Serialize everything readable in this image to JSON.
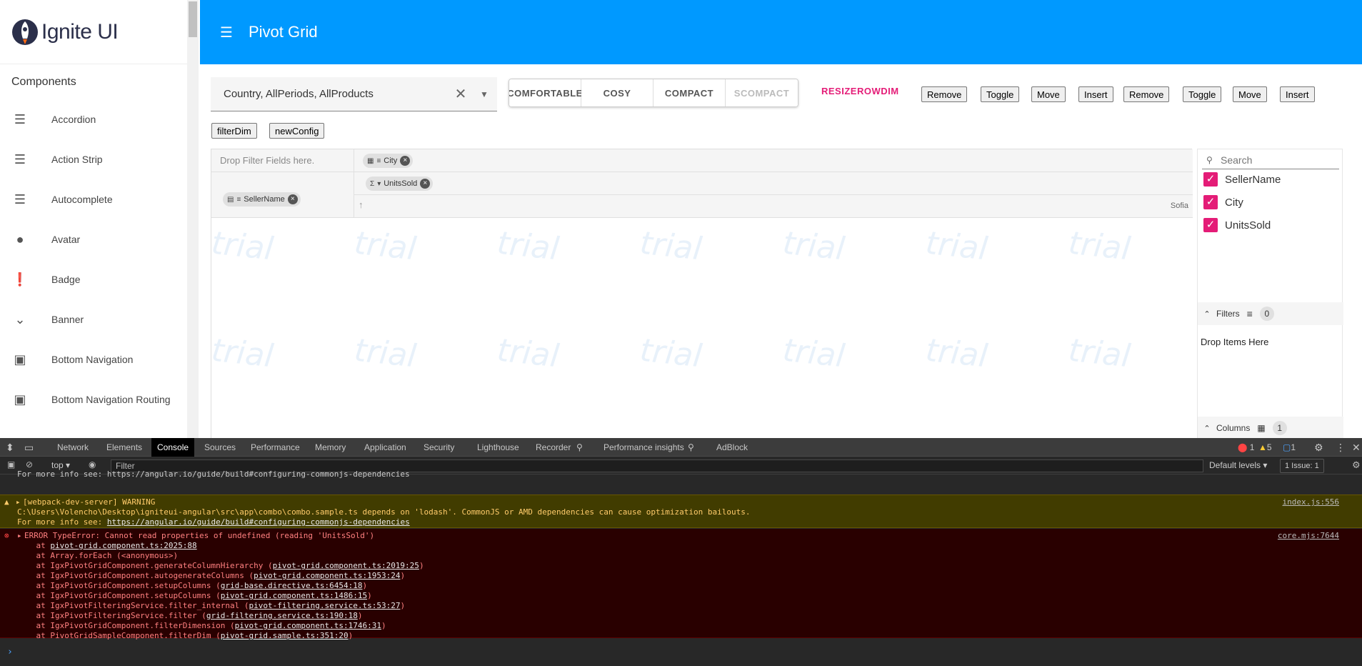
{
  "sidebar": {
    "logo": "Ignite UI",
    "section_title": "Components",
    "items": [
      {
        "label": "Accordion",
        "icon": "list-icon"
      },
      {
        "label": "Action Strip",
        "icon": "list-icon"
      },
      {
        "label": "Autocomplete",
        "icon": "list-icon"
      },
      {
        "label": "Avatar",
        "icon": "person-icon"
      },
      {
        "label": "Badge",
        "icon": "alert-icon"
      },
      {
        "label": "Banner",
        "icon": "chevron-down-icon"
      },
      {
        "label": "Bottom Navigation",
        "icon": "window-icon"
      },
      {
        "label": "Bottom Navigation Routing",
        "icon": "window-icon"
      }
    ]
  },
  "header": {
    "title": "Pivot Grid"
  },
  "toolbar": {
    "config_combo_value": "Country, AllPeriods, AllProducts",
    "density": [
      "COMFORTABLE",
      "COSY",
      "COMPACT",
      "SCOMPACT"
    ],
    "resize_label": "RESIZEROWDIM",
    "buttons_row1": [
      "Remove",
      "Toggle",
      "Move",
      "Insert",
      "Remove",
      "Toggle",
      "Move",
      "Insert"
    ],
    "buttons_row2": [
      "filterDim",
      "newConfig"
    ]
  },
  "pivot": {
    "filter_placeholder": "Drop Filter Fields here.",
    "column_chip": "City",
    "value_chip": "UnitsSold",
    "row_chip": "SellerName",
    "column_header": "Sofia",
    "watermark": "trial"
  },
  "selector": {
    "search_placeholder": "Search",
    "items": [
      "SellerName",
      "City",
      "UnitsSold"
    ],
    "filters_label": "Filters",
    "filters_count": "0",
    "drop_items": "Drop Items Here",
    "columns_label": "Columns",
    "columns_count": "1"
  },
  "devtools": {
    "tabs": [
      "Network",
      "Elements",
      "Console",
      "Sources",
      "Performance",
      "Memory",
      "Application",
      "Security",
      "Lighthouse",
      "Recorder",
      "Performance insights",
      "AdBlock"
    ],
    "context": "top",
    "filter_placeholder": "Filter",
    "levels": "Default levels",
    "issues": "1 Issue: 1",
    "counts": {
      "errors": "1",
      "warnings": "5",
      "messages": "1"
    },
    "truncated_line": "For more info see: https://angular.io/guide/build#configuring-commonjs-dependencies",
    "warning": {
      "line1": "[webpack-dev-server] WARNING",
      "line2": "C:\\Users\\Volencho\\Desktop\\igniteui-angular\\src\\app\\combo\\combo.sample.ts depends on 'lodash'. CommonJS or AMD dependencies can cause optimization bailouts.",
      "line3_prefix": "For more info see: ",
      "line3_link": "https://angular.io/guide/build#configuring-commonjs-dependencies",
      "source": "index.js:556"
    },
    "error": {
      "title": "ERROR TypeError: Cannot read properties of undefined (reading 'UnitsSold')",
      "source": "core.mjs:7644",
      "stack": [
        {
          "pre": "    at ",
          "link": "pivot-grid.component.ts:2025:88",
          "post": ""
        },
        {
          "pre": "    at Array.forEach (<anonymous>)",
          "link": "",
          "post": ""
        },
        {
          "pre": "    at IgxPivotGridComponent.generateColumnHierarchy (",
          "link": "pivot-grid.component.ts:2019:25",
          "post": ")"
        },
        {
          "pre": "    at IgxPivotGridComponent.autogenerateColumns (",
          "link": "pivot-grid.component.ts:1953:24",
          "post": ")"
        },
        {
          "pre": "    at IgxPivotGridComponent.setupColumns (",
          "link": "grid-base.directive.ts:6454:18",
          "post": ")"
        },
        {
          "pre": "    at IgxPivotGridComponent.setupColumns (",
          "link": "pivot-grid.component.ts:1486:15",
          "post": ")"
        },
        {
          "pre": "    at IgxPivotFilteringService.filter_internal (",
          "link": "pivot-filtering.service.ts:53:27",
          "post": ")"
        },
        {
          "pre": "    at IgxPivotFilteringService.filter (",
          "link": "grid-filtering.service.ts:190:18",
          "post": ")"
        },
        {
          "pre": "    at IgxPivotGridComponent.filterDimension (",
          "link": "pivot-grid.component.ts:1746:31",
          "post": ")"
        },
        {
          "pre": "    at PivotGridSampleComponent.filterDim (",
          "link": "pivot-grid.sample.ts:351:20",
          "post": ")"
        }
      ]
    },
    "prompt": "›"
  }
}
